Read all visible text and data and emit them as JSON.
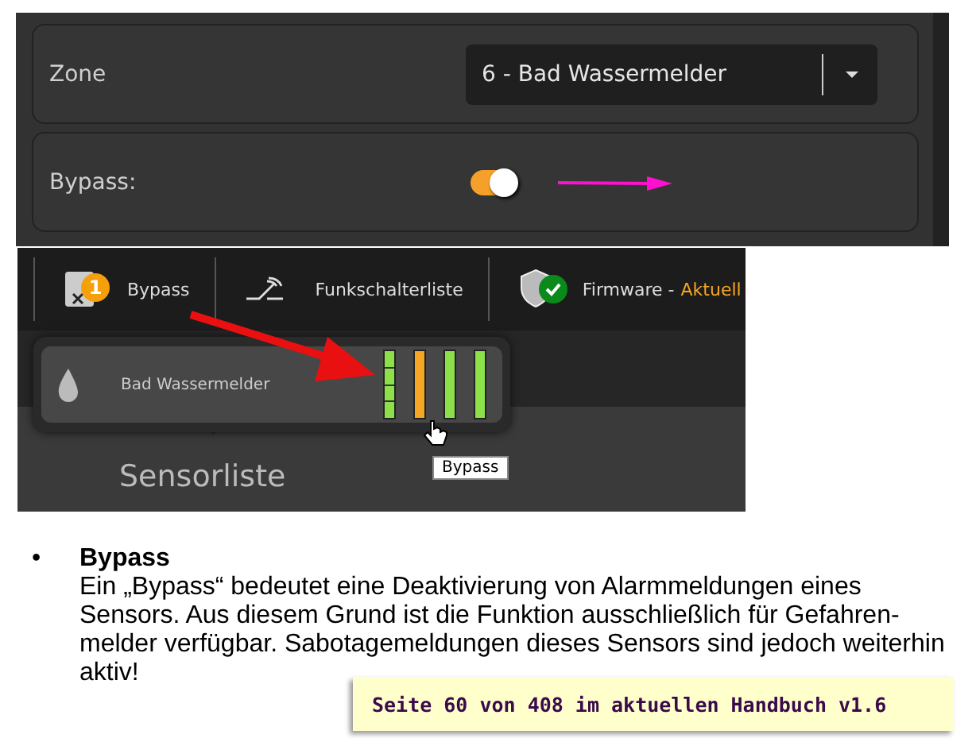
{
  "settings": {
    "rows": [
      {
        "kind": "select",
        "label": "Zone",
        "value": "6 - Bad Wassermelder"
      },
      {
        "kind": "toggle",
        "label": "Bypass:",
        "on": true
      }
    ]
  },
  "toolbar": {
    "items": [
      {
        "kind": "bypass",
        "label": "Bypass",
        "badge": "1"
      },
      {
        "kind": "switch",
        "label": "Funkschalterliste"
      },
      {
        "kind": "firmware",
        "label": "Firmware -",
        "status": "Aktuell"
      }
    ]
  },
  "sensor": {
    "name": "Bad Wassermelder",
    "bars": [
      {
        "color": "#8ee04a",
        "segmented": true
      },
      {
        "color": "#f5a623",
        "segmented": false
      },
      {
        "color": "#8ee04a",
        "segmented": false
      },
      {
        "color": "#8ee04a",
        "segmented": false
      }
    ]
  },
  "tooltip": "Bypass",
  "section_title": "Sensorliste",
  "doc": {
    "bullet": "•",
    "title": "Bypass",
    "text": "Ein „Bypass“ bedeutet eine Deaktivierung von Alarmmeldungen eines\nSensors. Aus diesem Grund ist die Funktion ausschließlich für Gefahren-\nmelder verfügbar. Sabotagemeldungen dieses Sensors sind jedoch weiterhin\naktiv!"
  },
  "page_note": "Seite 60 von 408 im aktuellen Handbuch v1.6"
}
